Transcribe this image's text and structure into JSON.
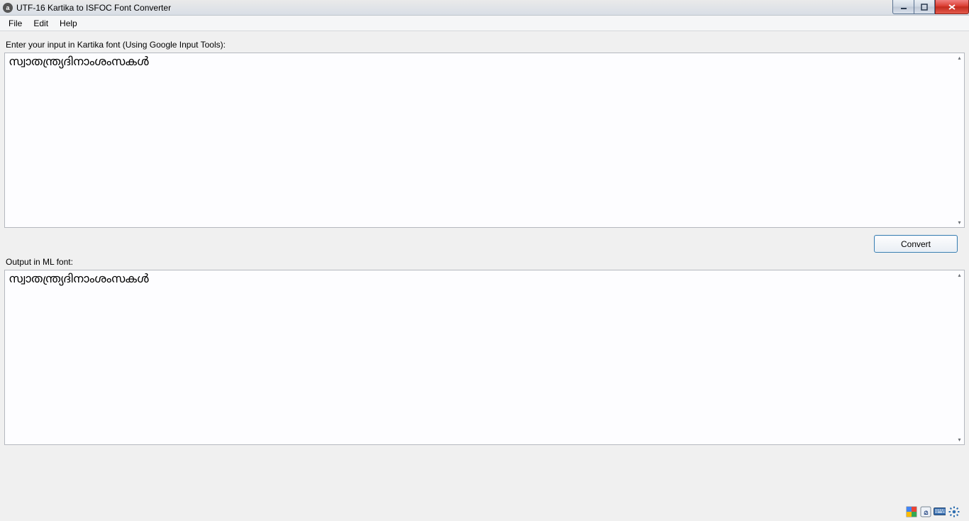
{
  "titlebar": {
    "title": "UTF-16 Kartika to ISFOC Font Converter"
  },
  "menubar": {
    "file": "File",
    "edit": "Edit",
    "help": "Help"
  },
  "main": {
    "input_label": "Enter your input in Kartika font (Using Google Input Tools):",
    "input_value": "സ്വാതന്ത്ര്യദിനാംശംസകൾ",
    "convert_label": "Convert",
    "output_label": "Output in ML font:",
    "output_value": "സ്വാതന്ത്ര്യദിനാംശംസകൾ"
  },
  "tray": {
    "icon1": "google-input-icon",
    "icon2": "language-icon",
    "icon3": "keyboard-icon",
    "icon4": "settings-icon"
  }
}
